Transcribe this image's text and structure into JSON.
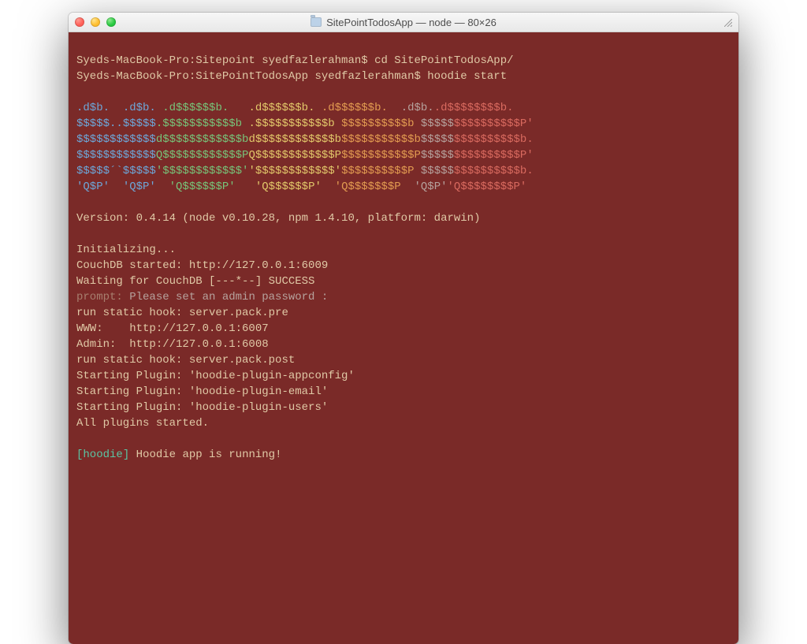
{
  "window": {
    "title": "SitePointTodosApp — node — 80×26"
  },
  "prompts": {
    "line1_prompt": "Syeds-MacBook-Pro:Sitepoint syedfazlerahman$ ",
    "line1_cmd": "cd SitePointTodosApp/",
    "line2_prompt": "Syeds-MacBook-Pro:SitePointTodosApp syedfazlerahman$ ",
    "line2_cmd": "hoodie start"
  },
  "ascii": {
    "a1": ".d$b.",
    "a2": "  .d$b.",
    "a3": " .d$$$$$$b.",
    "a4": "   .d$$$$$$b.",
    "a5": " .d$$$$$$b.",
    "a6": "  .d$b.",
    "a7": ".d$$$$$$$$b.",
    "b1": "$$$$$",
    "b2": "..$$$$$",
    "b3": ".$$$$$$$$$$$b",
    "b4": " .$$$$$$$$$$$b",
    "b5": " $$$$$$$$$$b",
    "b6": " $$$$$",
    "b7": "$$$$$$$$$$P'",
    "c1": "$$$$$$$$$$$$",
    "c2": "d$$$$$$$$$$$$b",
    "c3": "d$$$$$$$$$$$$b",
    "c4": "$$$$$$$$$$$b",
    "c5": "$$$$$",
    "c6": "$$$$$$$$$$b.",
    "d1": "$$$$$$$$$$$$",
    "d2": "Q$$$$$$$$$$$$P",
    "d3": "Q$$$$$$$$$$$$P",
    "d4": "$$$$$$$$$$$P",
    "d5": "$$$$$",
    "d6": "$$$$$$$$$$P'",
    "e1": "$$$$$´`$$$$$",
    "e2": "'$$$$$$$$$$$$'",
    "e3": "'$$$$$$$$$$$$'",
    "e4": "$$$$$$$$$$P",
    "e5": " $$$$$",
    "e6": "$$$$$$$$$$b.",
    "f1": "'Q$P'",
    "f2": "  'Q$P'",
    "f3": "  'Q$$$$$$P'",
    "f4": "   'Q$$$$$$P'",
    "f5": "  'Q$$$$$$$P",
    "f6": "  'Q$P'",
    "f7": "'Q$$$$$$$$P'"
  },
  "body": {
    "version": "Version: 0.4.14 (node v0.10.28, npm 1.4.10, platform: darwin)",
    "init": "Initializing...",
    "couch": "CouchDB started: http://127.0.0.1:6009",
    "waiting": "Waiting for CouchDB [---*--] SUCCESS",
    "prompt_label": "prompt:",
    "prompt_msg": " Please set an admin password :",
    "hook_pre": "run static hook: server.pack.pre",
    "www": "WWW:    http://127.0.0.1:6007",
    "admin": "Admin:  http://127.0.0.1:6008",
    "hook_post": "run static hook: server.pack.post",
    "plug1": "Starting Plugin: 'hoodie-plugin-appconfig'",
    "plug2": "Starting Plugin: 'hoodie-plugin-email'",
    "plug3": "Starting Plugin: 'hoodie-plugin-users'",
    "allstart": "All plugins started.",
    "tag_open": "[",
    "tag_name": "hoodie",
    "tag_close": "] ",
    "running": "Hoodie app is running!"
  }
}
